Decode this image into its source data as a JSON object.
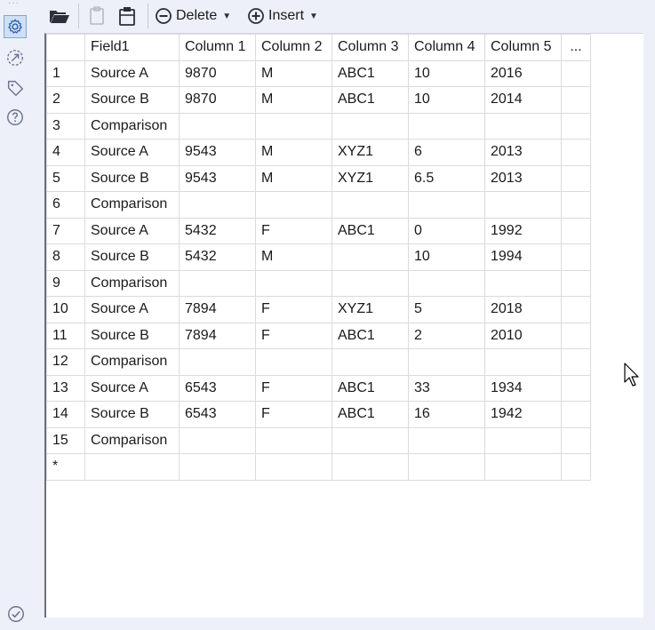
{
  "leftbar": {
    "icons": [
      "gear-icon",
      "arrow-connector-icon",
      "tag-icon",
      "help-icon",
      "check-circle-icon"
    ]
  },
  "toolbar": {
    "delete_label": "Delete",
    "insert_label": "Insert"
  },
  "grid": {
    "headers": [
      "Field1",
      "Column 1",
      "Column 2",
      "Column 3",
      "Column 4",
      "Column 5",
      "..."
    ],
    "rows": [
      {
        "num": "1",
        "cells": [
          "Source A",
          "9870",
          "M",
          "ABC1",
          "10",
          "2016",
          ""
        ]
      },
      {
        "num": "2",
        "cells": [
          "Source B",
          "9870",
          "M",
          "ABC1",
          "10",
          "2014",
          ""
        ]
      },
      {
        "num": "3",
        "cells": [
          "Comparison",
          "",
          "",
          "",
          "",
          "",
          ""
        ]
      },
      {
        "num": "4",
        "cells": [
          "Source A",
          "9543",
          "M",
          "XYZ1",
          "6",
          "2013",
          ""
        ]
      },
      {
        "num": "5",
        "cells": [
          "Source B",
          "9543",
          "M",
          "XYZ1",
          "6.5",
          "2013",
          ""
        ]
      },
      {
        "num": "6",
        "cells": [
          "Comparison",
          "",
          "",
          "",
          "",
          "",
          ""
        ]
      },
      {
        "num": "7",
        "cells": [
          "Source A",
          "5432",
          "F",
          "ABC1",
          "0",
          "1992",
          ""
        ]
      },
      {
        "num": "8",
        "cells": [
          "Source B",
          "5432",
          "M",
          "",
          "10",
          "1994",
          ""
        ]
      },
      {
        "num": "9",
        "cells": [
          "Comparison",
          "",
          "",
          "",
          "",
          "",
          ""
        ]
      },
      {
        "num": "10",
        "cells": [
          "Source A",
          "7894",
          "F",
          "XYZ1",
          "5",
          "2018",
          ""
        ]
      },
      {
        "num": "11",
        "cells": [
          "Source B",
          "7894",
          "F",
          "ABC1",
          "2",
          "2010",
          ""
        ]
      },
      {
        "num": "12",
        "cells": [
          "Comparison",
          "",
          "",
          "",
          "",
          "",
          ""
        ]
      },
      {
        "num": "13",
        "cells": [
          "Source A",
          "6543",
          "F",
          "ABC1",
          "33",
          "1934",
          ""
        ]
      },
      {
        "num": "14",
        "cells": [
          "Source B",
          "6543",
          "F",
          "ABC1",
          "16",
          "1942",
          ""
        ]
      },
      {
        "num": "15",
        "cells": [
          "Comparison",
          "",
          "",
          "",
          "",
          "",
          ""
        ]
      },
      {
        "num": "*",
        "cells": [
          "",
          "",
          "",
          "",
          "",
          "",
          ""
        ]
      }
    ]
  }
}
